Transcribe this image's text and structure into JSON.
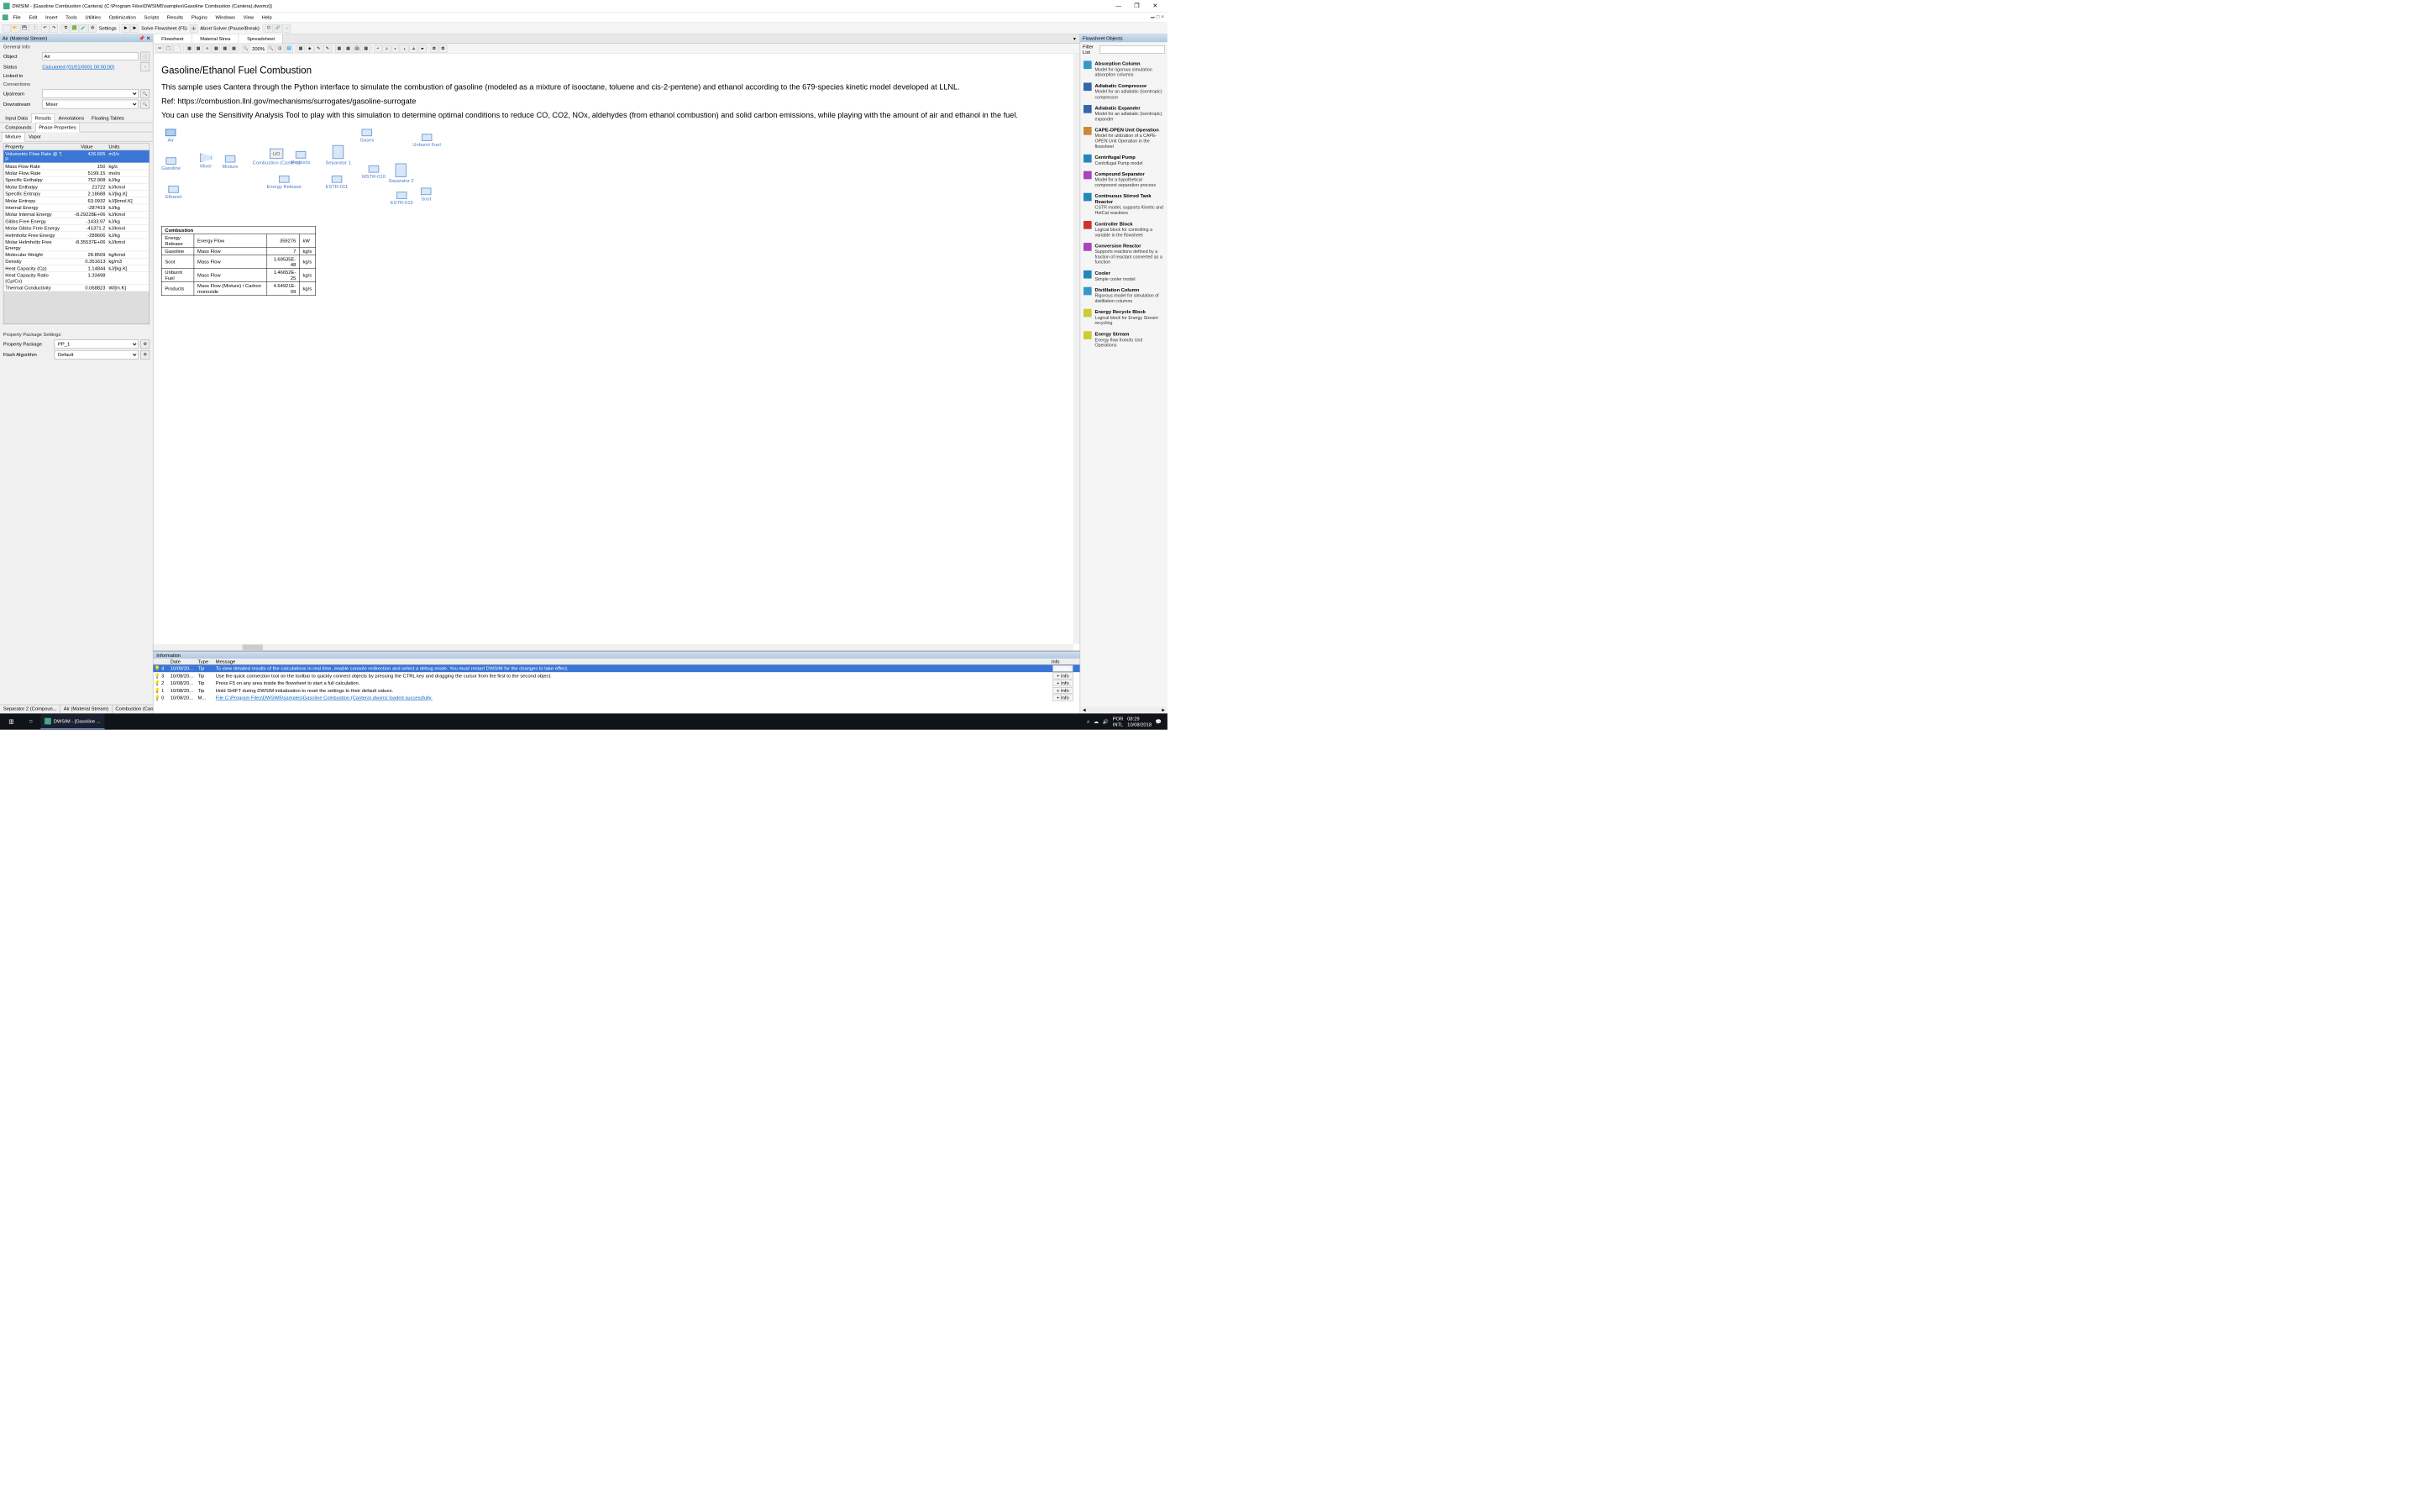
{
  "title": "DWSIM - [Gasoline Combustion (Cantera) (C:\\Program Files\\DWSIM5\\samples\\Gasoline Combustion (Cantera).dwxmz)]",
  "menu": [
    "File",
    "Edit",
    "Insert",
    "Tools",
    "Utilities",
    "Optimization",
    "Scripts",
    "Results",
    "Plugins",
    "Windows",
    "View",
    "Help"
  ],
  "toolbar": {
    "settings": "Settings",
    "solve": "Solve Flowsheet (F5)",
    "abort": "Abort Solver (Pause/Break)"
  },
  "left": {
    "title": "Air (Material Stream)",
    "general": "General Info",
    "object_lbl": "Object",
    "object_val": "Air",
    "status_lbl": "Status",
    "status_val": "Calculated (01/01/0001 00:00:00)",
    "linked_lbl": "Linked to",
    "conn": "Connections",
    "upstream_lbl": "Upstream",
    "upstream_val": "",
    "downstream_lbl": "Downstream",
    "downstream_val": "Mixer",
    "tabs1": [
      "Input Data",
      "Results",
      "Annotations",
      "Floating Tables"
    ],
    "tabs2": [
      "Compounds",
      "Phase Properties"
    ],
    "tabs3": [
      "Mixture",
      "Vapor"
    ],
    "cols": {
      "p": "Property",
      "v": "Value",
      "u": "Units"
    },
    "rows": [
      {
        "p": "Volumetric Flow Rate @ T, P",
        "v": "426.605",
        "u": "m3/s",
        "sel": true
      },
      {
        "p": "Mass Flow Rate",
        "v": "150",
        "u": "kg/s"
      },
      {
        "p": "Molar Flow Rate",
        "v": "5199.15",
        "u": "mol/s"
      },
      {
        "p": "Specific Enthalpy",
        "v": "752.908",
        "u": "kJ/kg"
      },
      {
        "p": "Molar Enthalpy",
        "v": "21722",
        "u": "kJ/kmol"
      },
      {
        "p": "Specific Entropy",
        "v": "2.18688",
        "u": "kJ/[kg.K]"
      },
      {
        "p": "Molar Entropy",
        "v": "63.0932",
        "u": "kJ/[kmol.K]"
      },
      {
        "p": "Internal Energy",
        "v": "-287419",
        "u": "kJ/kg"
      },
      {
        "p": "Molar Internal Energy",
        "v": "-8.29228E+06",
        "u": "kJ/kmol"
      },
      {
        "p": "Gibbs Free Energy",
        "v": "-1433.97",
        "u": "kJ/kg"
      },
      {
        "p": "Molar Gibbs Free Energy",
        "v": "-41371.2",
        "u": "kJ/kmol"
      },
      {
        "p": "Helmholtz Free Energy",
        "v": "-289606",
        "u": "kJ/kg"
      },
      {
        "p": "Molar Helmholtz Free Energy",
        "v": "-8.35537E+06",
        "u": "kJ/kmol"
      },
      {
        "p": "Molecular Weight",
        "v": "28.8509",
        "u": "kg/kmol"
      },
      {
        "p": "Density",
        "v": "0.351613",
        "u": "kg/m3"
      },
      {
        "p": "Heat Capacity (Cp)",
        "v": "1.14844",
        "u": "kJ/[kg.K]"
      },
      {
        "p": "Heat Capacity Ratio (Cp/Cv)",
        "v": "1.33498",
        "u": ""
      },
      {
        "p": "Thermal Conductivity",
        "v": "0.068823",
        "u": "W/[m.K]"
      }
    ],
    "pps": "Property Package Settings",
    "pp_lbl": "Property Package",
    "pp_val": "PP_1",
    "fa_lbl": "Flash Algorithm",
    "fa_val": "Default"
  },
  "center": {
    "tabs": [
      "Flowsheet",
      "Material Strea",
      "Spreadsheet"
    ],
    "zoom": "200%",
    "h1": "Gasoline/Ethanol Fuel Combustion",
    "p1": "This sample uses Cantera through the Python interface to simulate the combustion of gasoline (modeled as a mixture of isooctane, toluene and cis-2-pentene) and ethanol according to the 679-species kinetic model developed at LLNL.",
    "p2": "Ref: https://combustion.llnl.gov/mechanisms/surrogates/gasoline-surrogate",
    "p3": "You can use the Sensitivity Analysis Tool to play with this simulation to determine optimal conditions to reduce CO, CO2, NOx, aldehydes (from ethanol combustion) and solid carbon emissions, while playing with the amount of air and ethanol in the fuel.",
    "blocks": {
      "air": "Air",
      "gasoline": "Gasoline",
      "ethanol": "Ethanol",
      "mixer": "Mixer",
      "mixture": "Mixture",
      "uo": "UO",
      "combustion": "Combustion (Cantera)",
      "products": "Products",
      "sep1": "Separator 1",
      "gases": "Gases",
      "unburnt": "Unburnt Fuel",
      "mstr10": "MSTR-010",
      "sep2": "Separator 2",
      "estr11": "ESTR-011",
      "energy": "Energy Release",
      "estr15": "ESTR-015",
      "soot": "Soot"
    },
    "ct": {
      "title": "Combustion",
      "rows": [
        {
          "a": "Energy Release",
          "b": "Energy Flow",
          "c": "359276",
          "d": "kW"
        },
        {
          "a": "Gasoline",
          "b": "Mass Flow",
          "c": "7",
          "d": "kg/s"
        },
        {
          "a": "Soot",
          "b": "Mass Flow",
          "c": "1.69535E-48",
          "d": "kg/s"
        },
        {
          "a": "Unburnt Fuel",
          "b": "Mass Flow",
          "c": "1.46652E-25",
          "d": "kg/s"
        },
        {
          "a": "Products",
          "b": "Mass Flow (Mixture) / Carbon monoxide",
          "c": "4.64921E-09",
          "d": "kg/s"
        }
      ]
    }
  },
  "info": {
    "title": "Information",
    "cols": {
      "date": "Date",
      "type": "Type",
      "msg": "Message",
      "info": "Info"
    },
    "btn": "+ Info",
    "rows": [
      {
        "n": "4",
        "d": "10/08/20...",
        "t": "Tip",
        "m": "To view detailed results of the calculations in real time, enable console redirection and select a debug mode. You must restart DWSIM for the changes to take effect.",
        "sel": true
      },
      {
        "n": "3",
        "d": "10/08/20...",
        "t": "Tip",
        "m": "Use the quick connection tool on the toolbar to quickly connect objects by pressing the CTRL key and dragging the cursor from the first to the second object."
      },
      {
        "n": "2",
        "d": "10/08/20...",
        "t": "Tip",
        "m": "Press F5 on any area inside the flowsheet to start a full calculation."
      },
      {
        "n": "1",
        "d": "10/08/20...",
        "t": "Tip",
        "m": "Hold SHIFT during DWSIM initialization to reset the settings to their default values."
      },
      {
        "n": "0",
        "d": "10/08/20...",
        "t": "M...",
        "m": "File C:\\Program Files\\DWSIM5\\samples\\Gasoline Combustion (Cantera).dwxmz loaded successfully.",
        "link": true
      }
    ]
  },
  "right": {
    "title": "Flowsheet Objects",
    "filter": "Filter List",
    "items": [
      {
        "n": "Absorption Column",
        "d": "Model for rigorous simulation absorption columns",
        "c": "#39c"
      },
      {
        "n": "Adiabatic Compressor",
        "d": "Model for an adiabatic (isentropic) compressor",
        "c": "#36a"
      },
      {
        "n": "Adiabatic Expander",
        "d": "Model for an adiabatic (isentropic) expander",
        "c": "#36a"
      },
      {
        "n": "CAPE-OPEN Unit Operation",
        "d": "Model for utilization of a CAPE-OPEN Unit Operation in the flowsheet",
        "c": "#c83"
      },
      {
        "n": "Centrifugal Pump",
        "d": "Centrifugal Pump model",
        "c": "#28b"
      },
      {
        "n": "Compound Separator",
        "d": "Model for a hypothetical component separation process",
        "c": "#a4b"
      },
      {
        "n": "Continuous Stirred Tank Reactor",
        "d": "CSTR model, supports Kinetic and HetCat reactions",
        "c": "#28b"
      },
      {
        "n": "Controller Block",
        "d": "Logical block for controlling a variable in the flowsheet",
        "c": "#c33"
      },
      {
        "n": "Conversion Reactor",
        "d": "Supports reactions defined by a fraction of reactant converted as a function",
        "c": "#a4b"
      },
      {
        "n": "Cooler",
        "d": "Simple cooler model",
        "c": "#28b"
      },
      {
        "n": "Distillation Column",
        "d": "Rigorous model for simulation of distillation columns",
        "c": "#39c"
      },
      {
        "n": "Energy Recycle Block",
        "d": "Logical block for Energy Stream recycling",
        "c": "#cc3"
      },
      {
        "n": "Energy Stream",
        "d": "Energy flow from/to Unit Operations",
        "c": "#cc3"
      }
    ]
  },
  "bottomTabs": [
    "Separator 2 (Compoun...",
    "Air (Material Stream)",
    "Combustion (Cantera)"
  ],
  "taskbar": {
    "app": "DWSIM - [Gasoline ...",
    "lang": "POR",
    "kbd": "INTL",
    "time": "08:29",
    "date": "10/08/2018"
  }
}
